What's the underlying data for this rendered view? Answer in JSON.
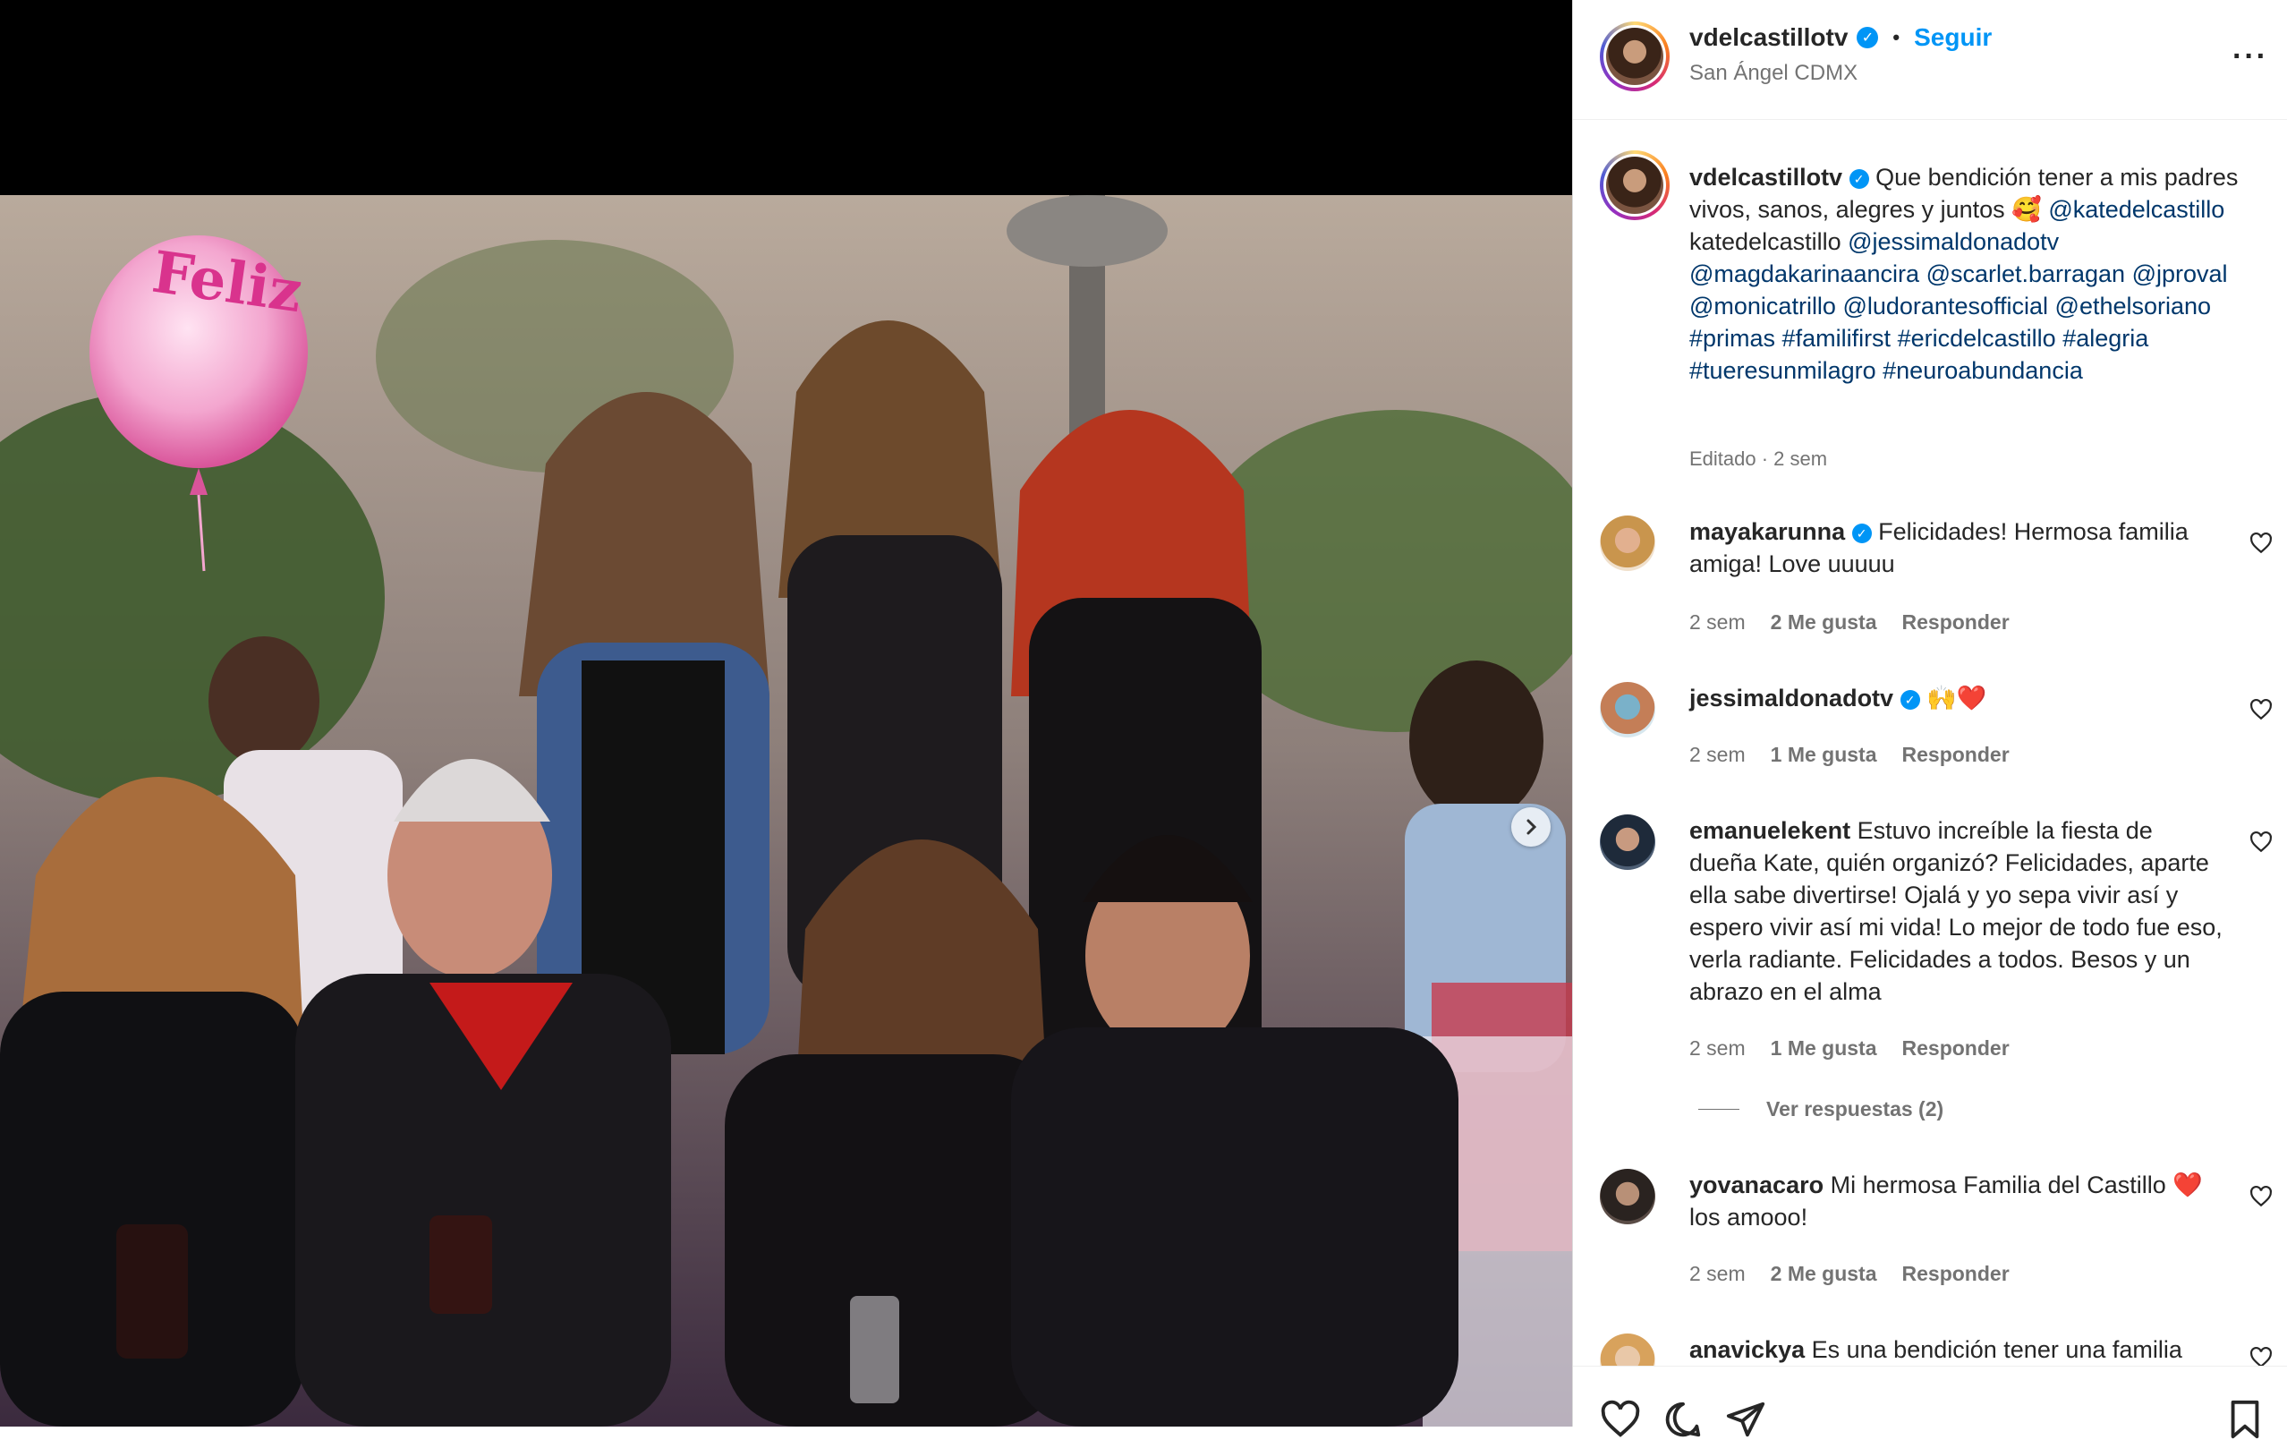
{
  "post": {
    "username": "vdelcastillotv",
    "follow_label": "Seguir",
    "location": "San Ángel CDMX",
    "more_label": "···",
    "media_next_label": "›",
    "balloon_text": "Feliz"
  },
  "caption": {
    "username": "vdelcastillotv",
    "text_1": "Que bendición tener a mis padres vivos, sanos, alegres y juntos 🥰",
    "mention_1": "@katedelcastillo",
    "text_2": "katedelcastillo",
    "tags": [
      "@jessimaldonadotv",
      "@magdakarinaancira",
      "@scarlet.barragan",
      "@jproval",
      "@monicatrillo",
      "@ludorantesofficial",
      "@ethelsoriano",
      "#primas",
      "#familifirst",
      "#ericdelcastillo",
      "#alegria",
      "#tueresunmilagro",
      "#neuroabundancia"
    ],
    "edited": "Editado · 2 sem"
  },
  "comments": [
    {
      "username": "mayakarunna",
      "verified": true,
      "text": "Felicidades! Hermosa familia amiga! Love uuuuu",
      "time": "2 sem",
      "likes": "2 Me gusta",
      "reply": "Responder"
    },
    {
      "username": "jessimaldonadotv",
      "verified": true,
      "text": "🙌❤️",
      "time": "2 sem",
      "likes": "1 Me gusta",
      "reply": "Responder"
    },
    {
      "username": "emanuelekent",
      "verified": false,
      "text": "Estuvo increíble la fiesta de dueña Kate, quién organizó? Felicidades, aparte ella sabe divertirse! Ojalá y yo sepa vivir así y espero vivir así mi vida! Lo mejor de todo fue eso, verla radiante. Felicidades a todos. Besos y un abrazo en el alma",
      "time": "2 sem",
      "likes": "1 Me gusta",
      "reply": "Responder"
    },
    {
      "username": "yovanacaro",
      "verified": false,
      "text": "Mi hermosa Familia del Castillo ❤️ los amooo!",
      "time": "2 sem",
      "likes": "2 Me gusta",
      "reply": "Responder"
    },
    {
      "username": "anavickya",
      "verified": false,
      "text": "Es una bendición tener una familia"
    }
  ],
  "view_replies": "Ver respuestas (2)",
  "icons": {
    "verified": "verified-badge-icon",
    "heart": "heart-icon",
    "comment": "comment-icon",
    "share": "share-icon",
    "save": "bookmark-icon",
    "next": "chevron-right-icon",
    "more": "more-options-icon"
  },
  "colors": {
    "link": "#00376b",
    "accent": "#0095f6",
    "muted": "#737373"
  }
}
